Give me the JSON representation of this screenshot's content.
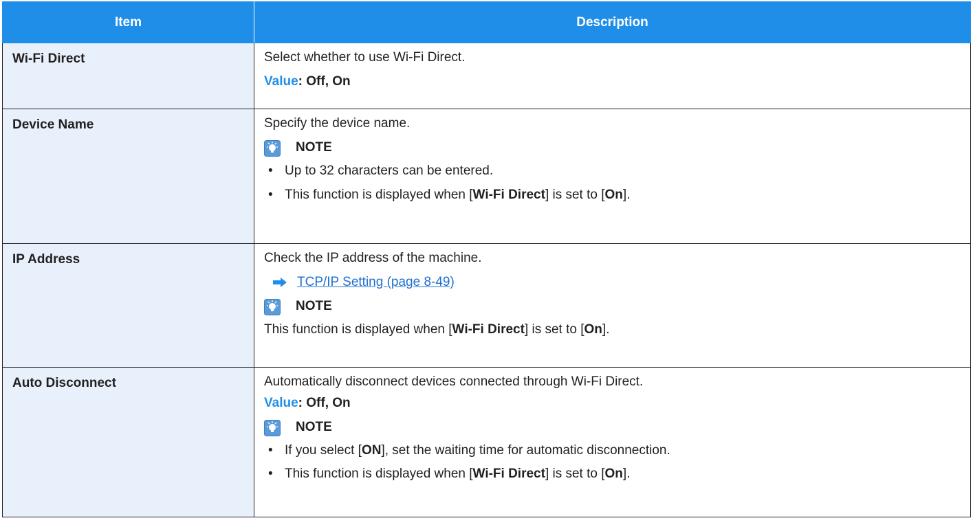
{
  "headers": {
    "item": "Item",
    "description": "Description"
  },
  "colors": {
    "header_bg": "#1f8ee9",
    "item_bg": "#e8f1fb",
    "value_label": "#1f8ee9",
    "link": "#1f6fd1"
  },
  "rows": [
    {
      "item": "Wi-Fi Direct",
      "text": "Select whether to use Wi-Fi Direct.",
      "value_label": "Value",
      "value": ": Off, On"
    },
    {
      "item": "Device Name",
      "text": "Specify the device name.",
      "note_label": "NOTE",
      "bullets": [
        {
          "text": "Up to 32 characters can be entered."
        },
        {
          "pre": "This function is displayed when [",
          "b1": "Wi-Fi Direct",
          "mid": "] is set to [",
          "b2": "On",
          "post": "]."
        }
      ]
    },
    {
      "item": "IP Address",
      "text": "Check the IP address of the machine.",
      "link": "TCP/IP Setting (page 8-49)",
      "note_label": "NOTE",
      "note": {
        "pre": "This function is displayed when [",
        "b1": "Wi-Fi Direct",
        "mid": "] is set to [",
        "b2": "On",
        "post": "]."
      }
    },
    {
      "item": "Auto Disconnect",
      "text": "Automatically disconnect devices connected through Wi-Fi Direct.",
      "value_label": "Value",
      "value": ": Off, On",
      "note_label": "NOTE",
      "bullets": [
        {
          "pre": "If you select [",
          "b1": "ON",
          "post": "], set the waiting time for automatic disconnection."
        },
        {
          "pre": "This function is displayed when [",
          "b1": "Wi-Fi Direct",
          "mid": "] is set to [",
          "b2": "On",
          "post": "]."
        }
      ]
    }
  ],
  "icons": {
    "note": "note-lightbulb-icon",
    "link": "arrow-right-icon"
  }
}
